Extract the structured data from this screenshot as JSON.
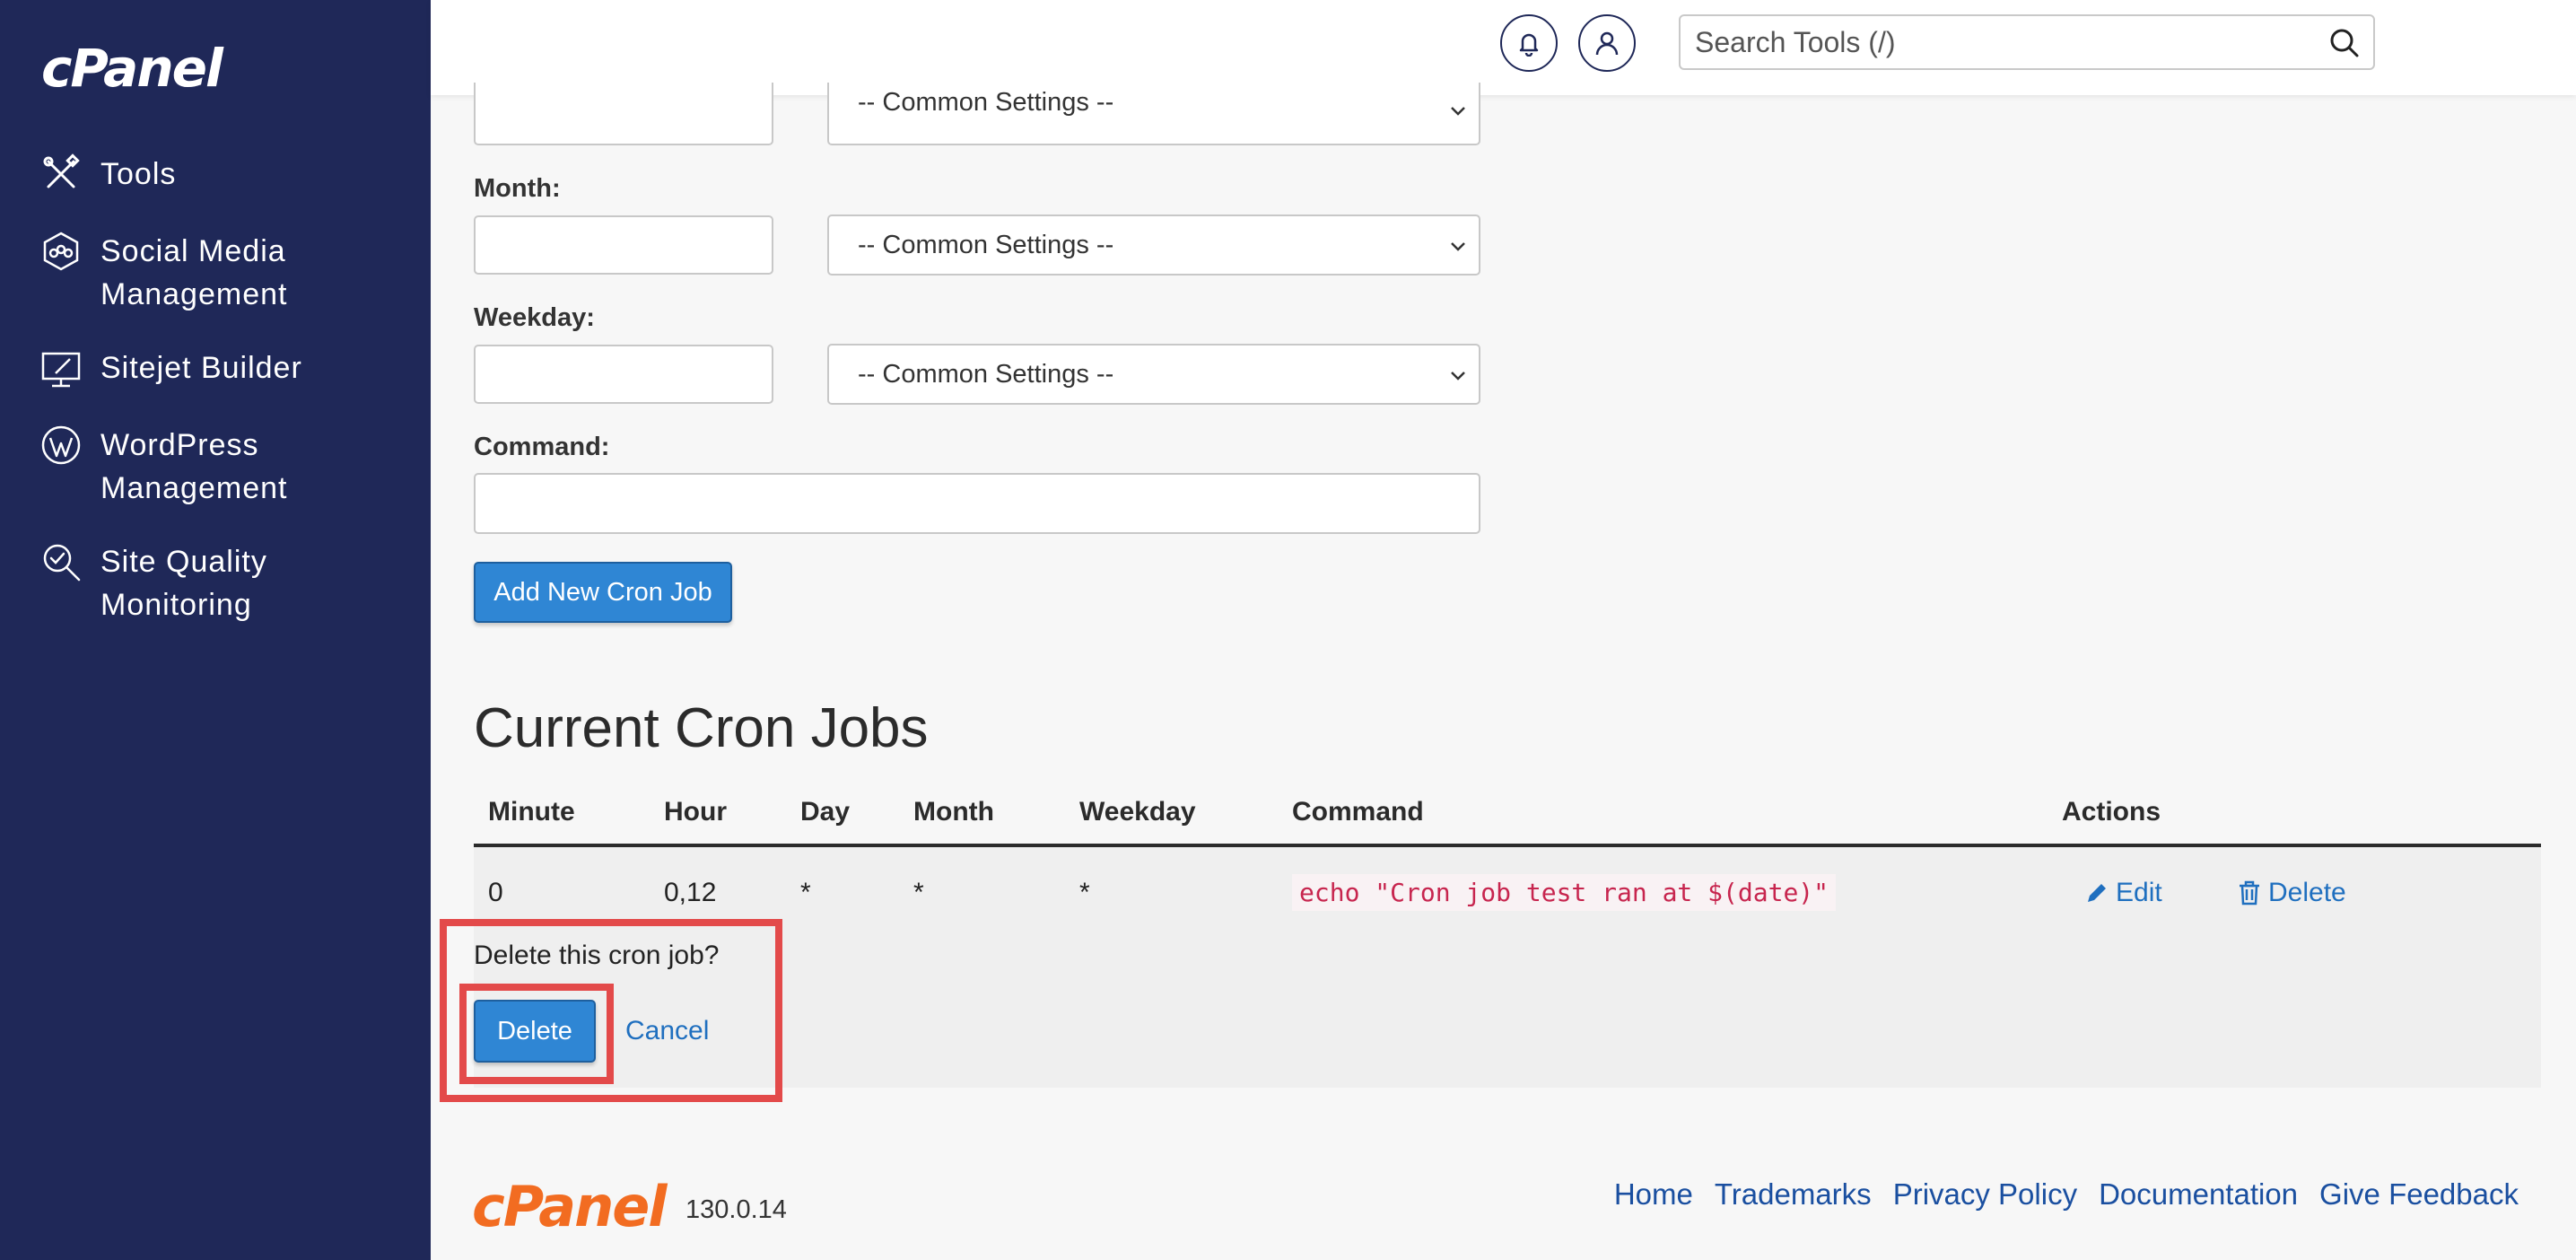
{
  "brand": {
    "logo_text": "cPanel",
    "version": "130.0.14"
  },
  "sidebar": {
    "items": [
      {
        "label": "Tools",
        "icon": "tools-icon"
      },
      {
        "label": "Social Media\nManagement",
        "icon": "social-media-icon"
      },
      {
        "label": "Sitejet Builder",
        "icon": "sitejet-icon"
      },
      {
        "label": "WordPress\nManagement",
        "icon": "wordpress-icon"
      },
      {
        "label": "Site Quality\nMonitoring",
        "icon": "site-quality-icon"
      }
    ]
  },
  "header": {
    "search_placeholder": "Search Tools (/)",
    "search_icon": "search-icon",
    "notifications_icon": "bell-icon",
    "user_icon": "user-icon"
  },
  "form": {
    "common_settings": "-- Common Settings --",
    "month_label": "Month:",
    "weekday_label": "Weekday:",
    "command_label": "Command:",
    "add_button": "Add New Cron Job"
  },
  "cron_jobs": {
    "title": "Current Cron Jobs",
    "columns": [
      "Minute",
      "Hour",
      "Day",
      "Month",
      "Weekday",
      "Command",
      "Actions"
    ],
    "rows": [
      {
        "minute": "0",
        "hour": "0,12",
        "day": "*",
        "month": "*",
        "weekday": "*",
        "command": "echo \"Cron job test ran at $(date)\"",
        "edit_label": "Edit",
        "delete_label": "Delete"
      }
    ],
    "confirm": {
      "question": "Delete this cron job?",
      "delete_label": "Delete",
      "cancel_label": "Cancel"
    }
  },
  "footer": {
    "links": [
      "Home",
      "Trademarks",
      "Privacy Policy",
      "Documentation",
      "Give Feedback"
    ]
  },
  "colors": {
    "sidebar_bg": "#1f2858",
    "primary_button": "#2f86d4",
    "link": "#1f6fbf",
    "highlight": "#e34a4a",
    "footer_logo": "#f26c21"
  }
}
